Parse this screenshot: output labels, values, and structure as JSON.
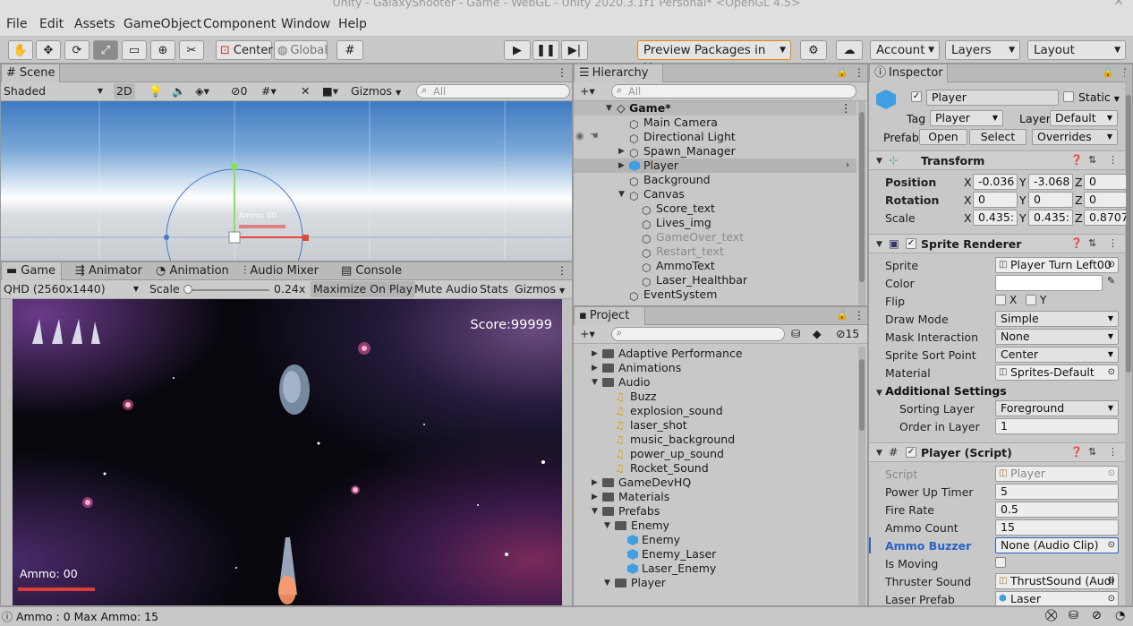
{
  "window": {
    "title": "Unity - GalaxyShooter - Game - WebGL - Unity 2020.3.1f1 Personal* <OpenGL 4.5>"
  },
  "menu": [
    "File",
    "Edit",
    "Assets",
    "GameObject",
    "Component",
    "Window",
    "Help"
  ],
  "toolbar": {
    "tools": [
      "hand-icon",
      "move-icon",
      "rotate-icon",
      "scale-icon",
      "rect-icon",
      "transform-icon",
      "custom-tool-icon"
    ],
    "pivot": "Center",
    "space": "Global",
    "preview_packages": "Preview Packages in Use",
    "account": "Account",
    "layers": "Layers",
    "layout": "Layout"
  },
  "scene": {
    "tab": "Scene",
    "shading": "Shaded",
    "mode2d": "2D",
    "hidden_count": "0",
    "gizmos": "Gizmos",
    "search_placeholder": "All",
    "ammo_label": "Ammo: 00"
  },
  "game": {
    "tabs": [
      "Game",
      "Animator",
      "Animation",
      "Audio Mixer",
      "Console"
    ],
    "resolution": "QHD (2560x1440)",
    "scale_label": "Scale",
    "scale_value": "0.24x",
    "maximize": "Maximize On Play",
    "mute": "Mute Audio",
    "stats": "Stats",
    "gizmos": "Gizmos",
    "score": "Score:99999",
    "ammo": "Ammo: 00"
  },
  "hierarchy": {
    "tab": "Hierarchy",
    "search_placeholder": "All",
    "scene_name": "Game*",
    "items": [
      {
        "label": "Main Camera",
        "depth": 1,
        "icon": "cube",
        "dim": false
      },
      {
        "label": "Directional Light",
        "depth": 1,
        "icon": "cube",
        "dim": false
      },
      {
        "label": "Spawn_Manager",
        "depth": 1,
        "icon": "cube",
        "dim": false,
        "arrow": "right"
      },
      {
        "label": "Player",
        "depth": 1,
        "icon": "blue",
        "dim": false,
        "arrow": "right",
        "selected": true
      },
      {
        "label": "Background",
        "depth": 1,
        "icon": "cube",
        "dim": false
      },
      {
        "label": "Canvas",
        "depth": 1,
        "icon": "cube",
        "dim": false,
        "arrow": "down"
      },
      {
        "label": "Score_text",
        "depth": 2,
        "icon": "cube",
        "dim": false
      },
      {
        "label": "Lives_img",
        "depth": 2,
        "icon": "cube",
        "dim": false
      },
      {
        "label": "GameOver_text",
        "depth": 2,
        "icon": "cube",
        "dim": true
      },
      {
        "label": "Restart_text",
        "depth": 2,
        "icon": "cube",
        "dim": true
      },
      {
        "label": "AmmoText",
        "depth": 2,
        "icon": "cube",
        "dim": false
      },
      {
        "label": "Laser_Healthbar",
        "depth": 2,
        "icon": "cube",
        "dim": false
      },
      {
        "label": "EventSystem",
        "depth": 1,
        "icon": "cube",
        "dim": false
      }
    ]
  },
  "project": {
    "tab": "Project",
    "hidden_count": "15",
    "items": [
      {
        "label": "Adaptive Performance",
        "depth": 1,
        "icon": "folder",
        "arrow": "right"
      },
      {
        "label": "Animations",
        "depth": 1,
        "icon": "folder",
        "arrow": "right"
      },
      {
        "label": "Audio",
        "depth": 1,
        "icon": "folder",
        "arrow": "down"
      },
      {
        "label": "Buzz",
        "depth": 2,
        "icon": "note"
      },
      {
        "label": "explosion_sound",
        "depth": 2,
        "icon": "note"
      },
      {
        "label": "laser_shot",
        "depth": 2,
        "icon": "note"
      },
      {
        "label": "music_background",
        "depth": 2,
        "icon": "note"
      },
      {
        "label": "power_up_sound",
        "depth": 2,
        "icon": "note"
      },
      {
        "label": "Rocket_Sound",
        "depth": 2,
        "icon": "note"
      },
      {
        "label": "GameDevHQ",
        "depth": 1,
        "icon": "folder",
        "arrow": "right"
      },
      {
        "label": "Materials",
        "depth": 1,
        "icon": "folder",
        "arrow": "right"
      },
      {
        "label": "Prefabs",
        "depth": 1,
        "icon": "folder",
        "arrow": "down"
      },
      {
        "label": "Enemy",
        "depth": 2,
        "icon": "folder",
        "arrow": "down"
      },
      {
        "label": "Enemy",
        "depth": 3,
        "icon": "blue"
      },
      {
        "label": "Enemy_Laser",
        "depth": 3,
        "icon": "blue"
      },
      {
        "label": "Laser_Enemy",
        "depth": 3,
        "icon": "blue"
      },
      {
        "label": "Player",
        "depth": 2,
        "icon": "folder",
        "arrow": "down"
      }
    ]
  },
  "inspector": {
    "tab": "Inspector",
    "object_name": "Player",
    "static_label": "Static",
    "tag_label": "Tag",
    "tag_value": "Player",
    "layer_label": "Layer",
    "layer_value": "Default",
    "prefab_label": "Prefab",
    "open": "Open",
    "select": "Select",
    "overrides": "Overrides",
    "transform": {
      "title": "Transform",
      "position_label": "Position",
      "rotation_label": "Rotation",
      "scale_label": "Scale",
      "position": [
        "-0.036",
        "-3.068",
        "0"
      ],
      "rotation": [
        "0",
        "0",
        "0"
      ],
      "scale": [
        "0.435:",
        "0.435:",
        "0.8707"
      ]
    },
    "sprite_renderer": {
      "title": "Sprite Renderer",
      "fields": [
        {
          "label": "Sprite",
          "value": "Player Turn Left00"
        },
        {
          "label": "Color",
          "value": ""
        },
        {
          "label": "Flip",
          "value": ""
        },
        {
          "label": "Draw Mode",
          "value": "Simple"
        },
        {
          "label": "Mask Interaction",
          "value": "None"
        },
        {
          "label": "Sprite Sort Point",
          "value": "Center"
        },
        {
          "label": "Material",
          "value": "Sprites-Default"
        }
      ],
      "flip_x": "X",
      "flip_y": "Y",
      "additional": "Additional Settings",
      "sorting_layer_label": "Sorting Layer",
      "sorting_layer": "Foreground",
      "order_label": "Order in Layer",
      "order": "1"
    },
    "player_script": {
      "title": "Player (Script)",
      "fields": [
        {
          "label": "Script",
          "value": "Player"
        },
        {
          "label": "Power Up Timer",
          "value": "5"
        },
        {
          "label": "Fire Rate",
          "value": "0.5"
        },
        {
          "label": "Ammo Count",
          "value": "15"
        },
        {
          "label": "Ammo Buzzer",
          "value": "None (Audio Clip)"
        },
        {
          "label": "Is Moving",
          "value": ""
        },
        {
          "label": "Thruster Sound",
          "value": "ThrustSound (Audi"
        },
        {
          "label": "Laser Prefab",
          "value": "Laser"
        }
      ]
    }
  },
  "status": {
    "message": "Ammo : 0 Max Ammo: 15"
  }
}
